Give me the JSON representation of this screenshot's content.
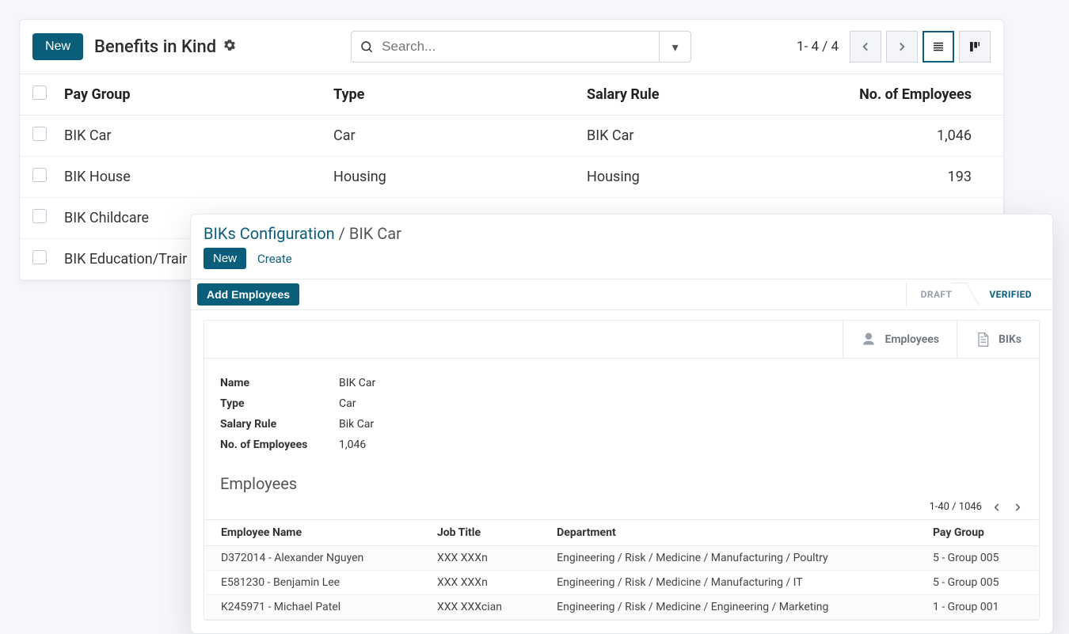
{
  "list": {
    "new_btn": "New",
    "title": "Benefits in Kind",
    "search_placeholder": "Search...",
    "pager": "1- 4 / 4",
    "columns": {
      "pay_group": "Pay Group",
      "type": "Type",
      "salary_rule": "Salary Rule",
      "no_emp": "No. of Employees"
    },
    "rows": [
      {
        "pay_group": "BIK Car",
        "type": "Car",
        "salary_rule": "BIK Car",
        "no_emp": "1,046"
      },
      {
        "pay_group": "BIK House",
        "type": "Housing",
        "salary_rule": "Housing",
        "no_emp": "193"
      },
      {
        "pay_group": "BIK Childcare",
        "type": "",
        "salary_rule": "",
        "no_emp": ""
      },
      {
        "pay_group": "BIK Education/Trair",
        "type": "",
        "salary_rule": "",
        "no_emp": ""
      }
    ]
  },
  "detail": {
    "breadcrumb_root": "BIKs Configuration",
    "breadcrumb_sep": " / ",
    "breadcrumb_here": "BIK Car",
    "new_btn": "New",
    "create_link": "Create",
    "add_employees": "Add Employees",
    "status_draft": "DRAFT",
    "status_verified": "VERIFIED",
    "tab_employees": "Employees",
    "tab_biks": "BIKs",
    "fields": {
      "name_label": "Name",
      "name_value": "BIK Car",
      "type_label": "Type",
      "type_value": "Car",
      "rule_label": "Salary Rule",
      "rule_value": "Bik Car",
      "emp_label": "No. of Employees",
      "emp_value": "1,046"
    },
    "employees_heading": "Employees",
    "employees_pager": "1-40 / 1046",
    "etable": {
      "col_name": "Employee Name",
      "col_job": "Job Title",
      "col_dept": "Department",
      "col_pg": "Pay Group",
      "rows": [
        {
          "name": "D372014 - Alexander Nguyen",
          "job": "XXX XXXn",
          "dept": "Engineering / Risk / Medicine / Manufacturing / Poultry",
          "pg": "5 - Group 005"
        },
        {
          "name": "E581230 - Benjamin Lee",
          "job": "XXX XXXn",
          "dept": "Engineering / Risk / Medicine / Manufacturing / IT",
          "pg": "5 - Group 005"
        },
        {
          "name": "K245971 - Michael Patel",
          "job": "XXX XXXcian",
          "dept": "Engineering / Risk / Medicine / Engineering / Marketing",
          "pg": "1 - Group 001"
        }
      ]
    }
  }
}
